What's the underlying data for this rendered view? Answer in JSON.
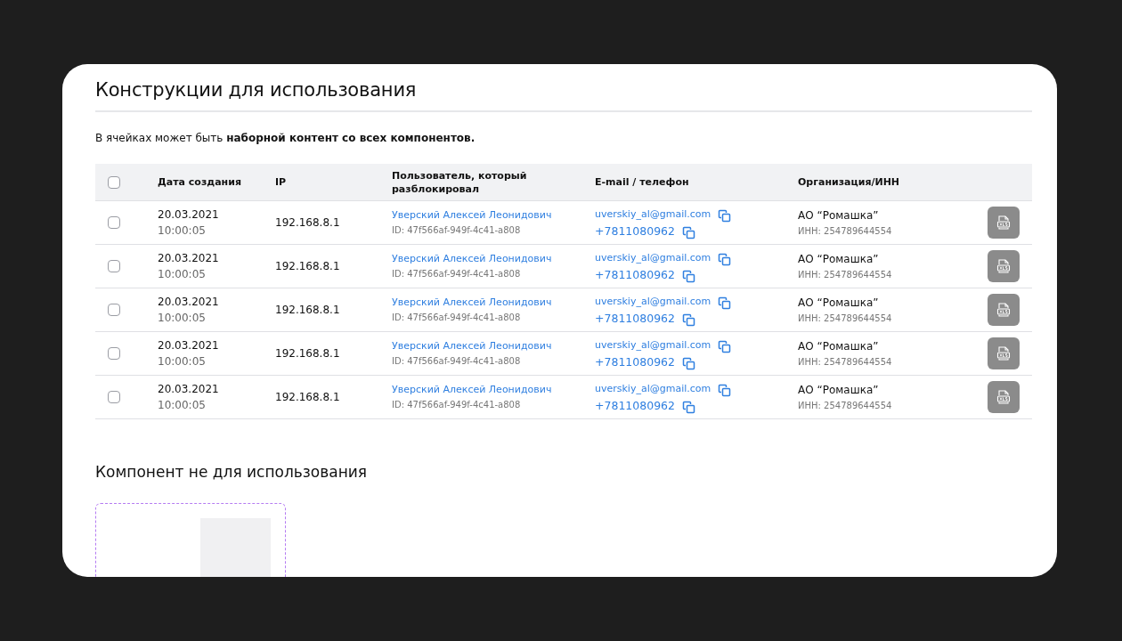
{
  "title": "Конструкции для использования",
  "description": "В ячейках может быть **наборной контент со всех компонентов.**",
  "table": {
    "select_all": {
      "checked": false
    },
    "columns": [
      "Дата создания",
      "IP",
      "Пользователь, который разблокировал",
      "E-mail / телефон",
      "Организация/ИНН"
    ],
    "rows": [
      {
        "checked": false,
        "date": "20.03.2021",
        "time": "10:00:05",
        "ip": "192.168.8.1",
        "user": "Уверский Алексей Леонидович",
        "user_id": "ID: 47f566af-949f-4c41-a808",
        "email": "uverskiy_al@gmail.com",
        "phone": "+7811080962",
        "org": "АО “Ромашка”",
        "inn": "ИНН: 254789644554"
      },
      {
        "checked": false,
        "date": "20.03.2021",
        "time": "10:00:05",
        "ip": "192.168.8.1",
        "user": "Уверский Алексей Леонидович",
        "user_id": "ID: 47f566af-949f-4c41-a808",
        "email": "uverskiy_al@gmail.com",
        "phone": "+7811080962",
        "org": "АО “Ромашка”",
        "inn": "ИНН: 254789644554"
      },
      {
        "checked": false,
        "date": "20.03.2021",
        "time": "10:00:05",
        "ip": "192.168.8.1",
        "user": "Уверский Алексей Леонидович",
        "user_id": "ID: 47f566af-949f-4c41-a808",
        "email": "uverskiy_al@gmail.com",
        "phone": "+7811080962",
        "org": "АО “Ромашка”",
        "inn": "ИНН: 254789644554"
      },
      {
        "checked": false,
        "date": "20.03.2021",
        "time": "10:00:05",
        "ip": "192.168.8.1",
        "user": "Уверский Алексей Леонидович",
        "user_id": "ID: 47f566af-949f-4c41-a808",
        "email": "uverskiy_al@gmail.com",
        "phone": "+7811080962",
        "org": "АО “Ромашка”",
        "inn": "ИНН: 254789644554"
      },
      {
        "checked": false,
        "date": "20.03.2021",
        "time": "10:00:05",
        "ip": "192.168.8.1",
        "user": "Уверский Алексей Леонидович",
        "user_id": "ID: 47f566af-949f-4c41-a808",
        "email": "uverskiy_al@gmail.com",
        "phone": "+7811080962",
        "org": "АО “Ромашка”",
        "inn": "ИНН: 254789644554"
      }
    ]
  },
  "section_title": "Компонент не для использования"
}
